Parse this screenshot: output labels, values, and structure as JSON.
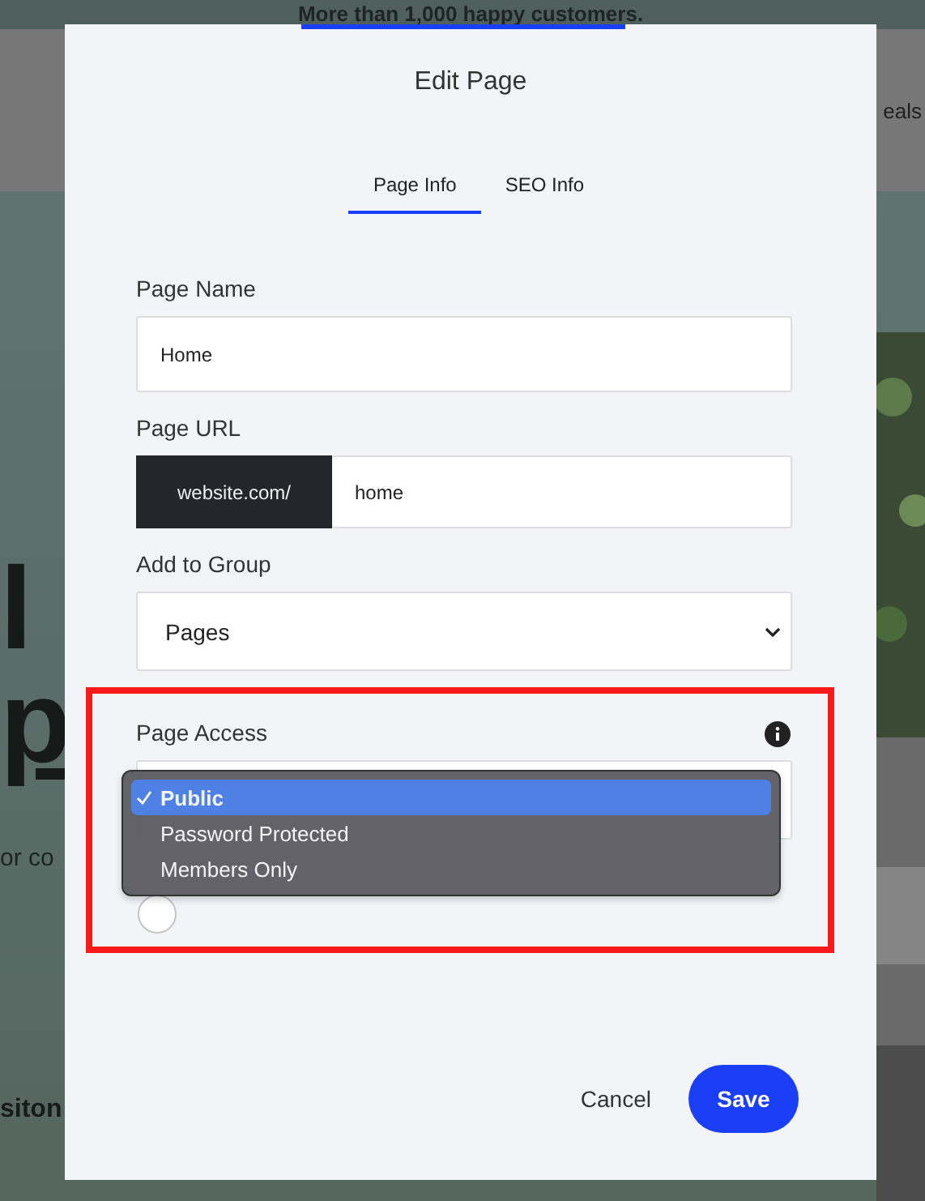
{
  "background": {
    "banner": "More than 1,000 happy customers.",
    "nav_fragment": "eals",
    "hero_fragments": [
      "l",
      "p"
    ],
    "body_fragment": "or co",
    "caption_fragment": "siton"
  },
  "dialog": {
    "title": "Edit Page",
    "tabs": [
      {
        "label": "Page Info",
        "selected": true
      },
      {
        "label": "SEO Info",
        "selected": false
      }
    ],
    "page_name": {
      "label": "Page Name",
      "value": "Home"
    },
    "page_url": {
      "label": "Page URL",
      "prefix": "website.com/",
      "value": "home"
    },
    "group": {
      "label": "Add to Group",
      "value": "Pages"
    },
    "access": {
      "label": "Page Access",
      "expanded": true,
      "alt_header_radio": {
        "checked": false
      },
      "options": [
        {
          "label": "Public",
          "selected": true
        },
        {
          "label": "Password Protected",
          "selected": false
        },
        {
          "label": "Members Only",
          "selected": false
        }
      ]
    },
    "buttons": [
      {
        "label": "Cancel",
        "kind": "text"
      },
      {
        "label": "Save",
        "kind": "primary"
      }
    ]
  }
}
